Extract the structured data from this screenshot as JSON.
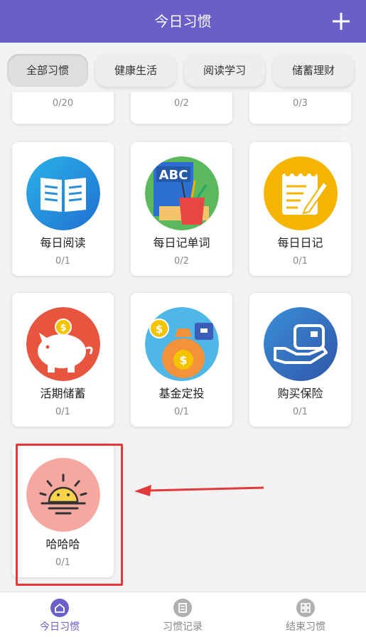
{
  "header": {
    "title": "今日习惯"
  },
  "tabs": [
    {
      "label": "全部习惯",
      "active": true
    },
    {
      "label": "健康生活"
    },
    {
      "label": "阅读学习"
    },
    {
      "label": "储蓄理财"
    }
  ],
  "partial_row": [
    {
      "count": "0/20"
    },
    {
      "count": "0/2"
    },
    {
      "count": "0/3"
    }
  ],
  "habits": [
    {
      "name": "每日阅读",
      "count": "0/1",
      "icon": "book-icon"
    },
    {
      "name": "每日记单词",
      "count": "0/2",
      "icon": "abc-book-icon"
    },
    {
      "name": "每日日记",
      "count": "0/1",
      "icon": "notepad-icon"
    },
    {
      "name": "活期储蓄",
      "count": "0/1",
      "icon": "piggy-bank-icon"
    },
    {
      "name": "基金定投",
      "count": "0/1",
      "icon": "money-bag-icon"
    },
    {
      "name": "购买保险",
      "count": "0/1",
      "icon": "insurance-hand-icon"
    },
    {
      "name": "哈哈哈",
      "count": "0/1",
      "icon": "sunrise-icon"
    }
  ],
  "bottom_nav": [
    {
      "label": "今日习惯",
      "active": true,
      "icon": "home-icon"
    },
    {
      "label": "习惯记录",
      "icon": "record-icon"
    },
    {
      "label": "结束习惯",
      "icon": "grid-icon"
    }
  ],
  "colors": {
    "accent": "#6a5fc9",
    "highlight": "#e23a3a"
  }
}
